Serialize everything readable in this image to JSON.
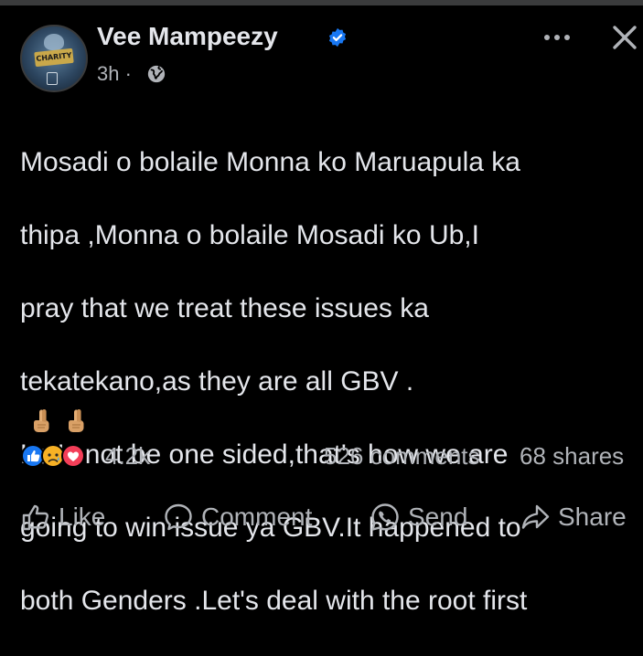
{
  "post": {
    "author": "Vee Mampeezy",
    "avatar_badge": "CHARITY",
    "time": "3h",
    "separator": "·",
    "lines": [
      "Mosadi o bolaile Monna ko Maruapula ka",
      "thipa ,Monna o bolaile Mosadi ko Ub,I",
      "pray that we treat these issues ka",
      "tekatekano,as they are all GBV .",
      "Let's not be one sided,that's how we are",
      "going to win issue ya GBV.It happened to",
      "both Genders .Let's deal with the root first"
    ],
    "emojis": [
      "fingers-crossed",
      "fingers-crossed"
    ]
  },
  "stats": {
    "reactions": [
      "like",
      "sad",
      "love"
    ],
    "reaction_count": "4.2k",
    "comments": "526 comments",
    "shares": "68 shares"
  },
  "actions": {
    "like": "Like",
    "comment": "Comment",
    "send": "Send",
    "share": "Share"
  },
  "colors": {
    "background": "#000000",
    "text": "#e4e6eb",
    "muted": "#b0b3b8",
    "verified": "#1877f2",
    "like": "#1877f2",
    "love": "#f33e58",
    "sad": "#f7b125"
  }
}
